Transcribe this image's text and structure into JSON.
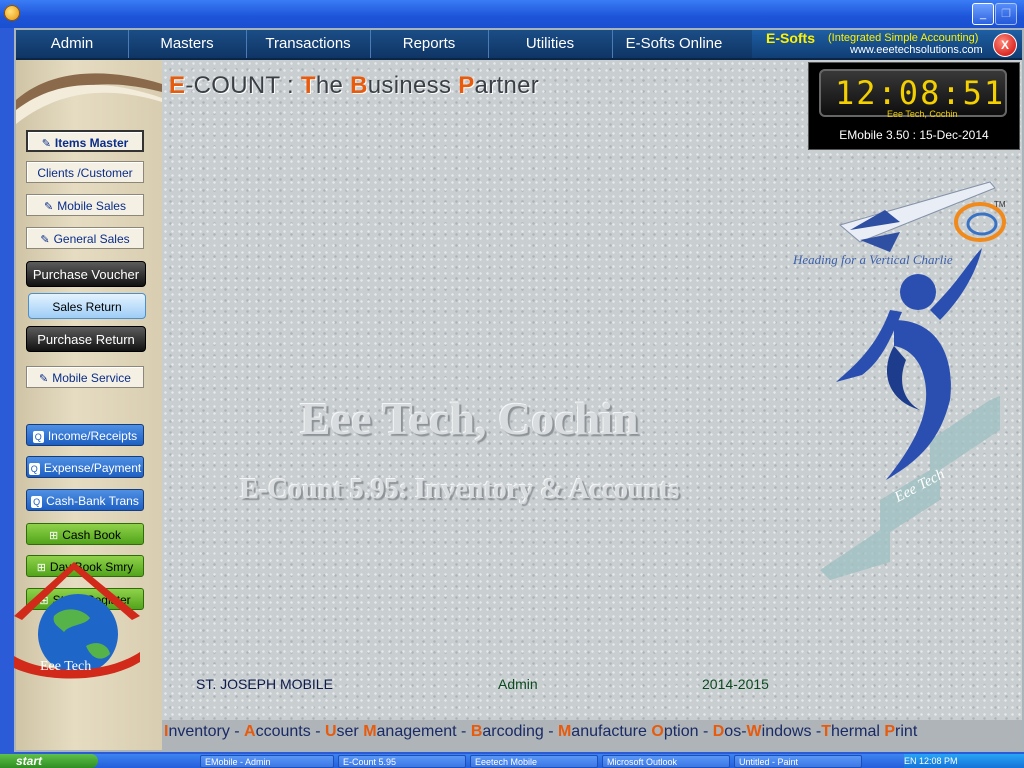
{
  "titlebar": {
    "min_icon": "minimize-icon",
    "max_icon": "restore-icon"
  },
  "menubar": {
    "items": [
      {
        "label": "Admin"
      },
      {
        "label": "Masters"
      },
      {
        "label": "Transactions"
      },
      {
        "label": "Reports"
      },
      {
        "label": "Utilities"
      },
      {
        "label": "E-Softs Online"
      }
    ],
    "brand_name": "E-Softs",
    "brand_sub": "(Integrated Simple Accounting)",
    "brand_url": "www.eeetechsolutions.com",
    "close_label": "X"
  },
  "sidebar": {
    "items_master": "Items Master",
    "clients": "Clients /Customer",
    "mobile_sales": "Mobile Sales",
    "general_sales": "General Sales",
    "purchase_voucher": "Purchase Voucher",
    "sales_return": "Sales Return",
    "purchase_return": "Purchase Return",
    "mobile_service": "Mobile Service",
    "income_receipts": "Income/Receipts",
    "expense_payment": "Expense/Payment",
    "cash_bank": "Cash-Bank Trans",
    "cash_book": "Cash Book",
    "day_book": "Day Book Smry",
    "stock_register": "Stock Register",
    "logo_text": "Eee Tech"
  },
  "header": {
    "p1c": "E",
    "p1": "-COUNT : ",
    "p2c": "T",
    "p2": "he ",
    "p3c": "B",
    "p3": "usiness ",
    "p4c": "P",
    "p4": "artner"
  },
  "clock": {
    "time": "12:08:51",
    "sub": "Eee Tech, Cochin",
    "caption": "EMobile 3.50 : 15-Dec-2014"
  },
  "watermark": {
    "line1": "Eee Tech, Cochin",
    "line2": "E-Count 5.95: Inventory & Accounts"
  },
  "logo": {
    "tagline": "Heading for a Vertical Charlie",
    "tm": "TM",
    "script": "Eee Tech"
  },
  "status": {
    "company": "ST. JOSEPH MOBILE",
    "user": "Admin",
    "year": "2014-2015"
  },
  "features": [
    {
      "c": "I",
      "t": "nventory - "
    },
    {
      "c": "A",
      "t": "ccounts - "
    },
    {
      "c": "U",
      "t": "ser "
    },
    {
      "c": "M",
      "t": "anagement - "
    },
    {
      "c": "B",
      "t": "arcoding - "
    },
    {
      "c": "M",
      "t": "anufacture "
    },
    {
      "c": "O",
      "t": "ption - "
    },
    {
      "c": "D",
      "t": "os-"
    },
    {
      "c": "W",
      "t": "indows -"
    },
    {
      "c": "T",
      "t": "hermal "
    },
    {
      "c": "P",
      "t": "rint"
    }
  ],
  "taskbar": {
    "start": "start",
    "tasks": [
      "EMobile - Admin",
      "E-Count 5.95",
      "Eeetech Mobile",
      "Microsoft Outlook",
      "Untitled - Paint"
    ],
    "tray": "EN  12:08 PM"
  },
  "colors": {
    "accent": "#e85a0c",
    "menubar": "#1b4d86",
    "brand_yellow": "#fff200"
  }
}
